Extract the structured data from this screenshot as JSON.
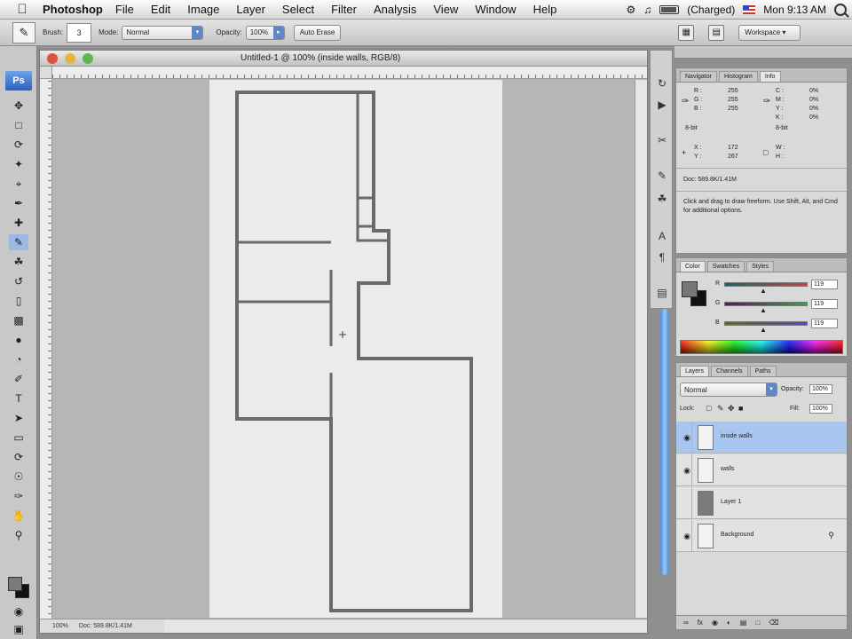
{
  "menubar": {
    "app_name": "Photoshop",
    "items": [
      "File",
      "Edit",
      "Image",
      "Layer",
      "Select",
      "Filter",
      "Analysis",
      "View",
      "Window",
      "Help"
    ],
    "battery_text": "(Charged)",
    "clock": "Mon 9:13 AM"
  },
  "options": {
    "brush_label": "Brush:",
    "brush_size": "3",
    "mode_label": "Mode:",
    "mode_value": "Normal",
    "opacity_label": "Opacity:",
    "opacity_value": "100%",
    "auto_erase": "Auto Erase",
    "workspace": "Workspace"
  },
  "document": {
    "title": "Untitled-1 @ 100% (inside walls, RGB/8)",
    "zoom": "100%",
    "doc_size": "Doc: 589.8K/1.41M"
  },
  "info_panel": {
    "tabs": [
      "Navigator",
      "Histogram",
      "Info"
    ],
    "rgb_labels": [
      "R :",
      "G :",
      "B :"
    ],
    "rgb_values": [
      "255",
      "255",
      "255"
    ],
    "cmyk_labels": [
      "C :",
      "M :",
      "Y :",
      "K :"
    ],
    "cmyk_values": [
      "0%",
      "0%",
      "0%",
      "0%"
    ],
    "bit_a": "8-bit",
    "bit_b": "8-bit",
    "x_label": "X :",
    "x_value": "172",
    "y_label": "Y :",
    "y_value": "267",
    "w_label": "W :",
    "h_label": "H :",
    "doc": "Doc: 589.8K/1.41M",
    "hint": "Click and drag to draw freeform. Use Shift, Alt, and Cmd for additional options."
  },
  "color_panel": {
    "tabs": [
      "Color",
      "Swatches",
      "Styles"
    ],
    "channels": [
      "R",
      "G",
      "B"
    ],
    "values": [
      "119",
      "119",
      "119"
    ],
    "level": 0.47
  },
  "layers_panel": {
    "tabs": [
      "Layers",
      "Channels",
      "Paths"
    ],
    "blend_mode": "Normal",
    "opacity_label": "Opacity:",
    "opacity": "100%",
    "lock_label": "Lock:",
    "fill_label": "Fill:",
    "fill": "100%",
    "layers": [
      {
        "name": "inside walls",
        "visible": true,
        "selected": true
      },
      {
        "name": "walls",
        "visible": true,
        "selected": false
      },
      {
        "name": "Layer 1",
        "visible": false,
        "selected": false
      },
      {
        "name": "Background",
        "visible": true,
        "selected": false
      }
    ]
  },
  "colors": {
    "selection": "#a8c6ef",
    "wall": "#6a6a6a",
    "accent_blue": "#3f7fd8"
  }
}
